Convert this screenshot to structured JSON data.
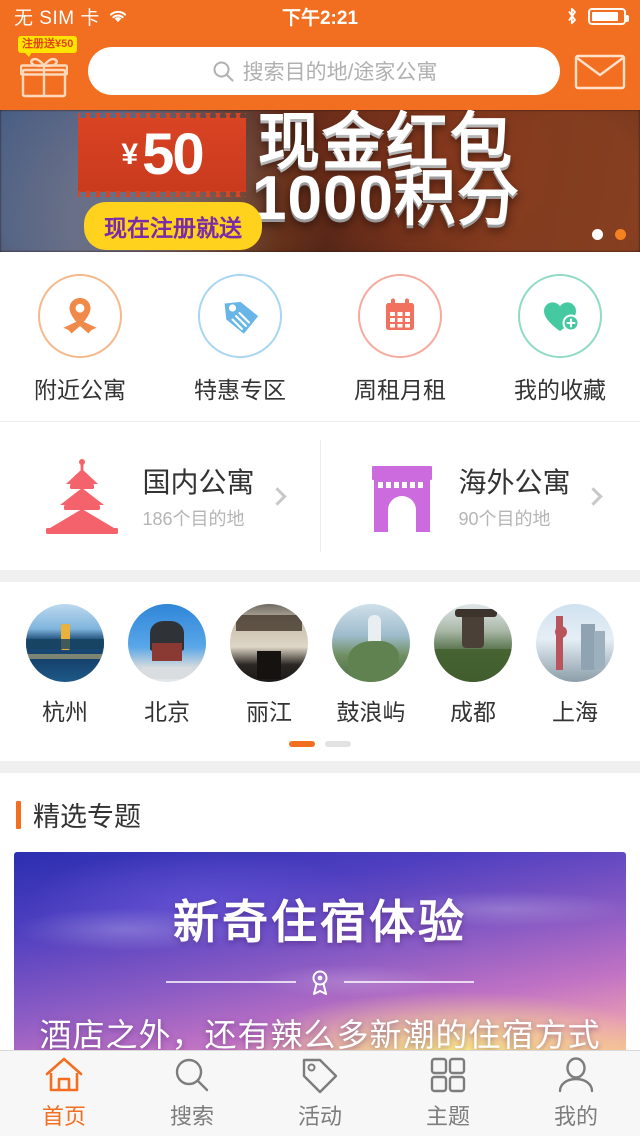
{
  "status_bar": {
    "carrier": "无 SIM 卡",
    "time": "下午2:21",
    "wifi_icon": "wifi-icon",
    "bluetooth_icon": "bluetooth-icon",
    "battery_icon": "battery-icon",
    "battery_level": 88
  },
  "header": {
    "gift_icon": "gift-icon",
    "gift_badge": "注册送¥50",
    "search_placeholder": "搜索目的地/途家公寓",
    "search_value": "",
    "search_icon": "search-icon",
    "mail_icon": "mail-icon"
  },
  "banner": {
    "coupon_currency": "¥",
    "coupon_amount": "50",
    "headline": "现金红包",
    "headline2": "1000积分",
    "pill": "现在注册就送",
    "dots": 2,
    "active_dot": 1,
    "active_dot_color": "#f58220"
  },
  "quick_actions": [
    {
      "label": "附近公寓",
      "icon": "location-pin-icon",
      "color": "#f08a4b",
      "ring": "#f5b98c"
    },
    {
      "label": "特惠专区",
      "icon": "price-tag-icon",
      "color": "#68b6e8",
      "ring": "#a9d6f2"
    },
    {
      "label": "周租月租",
      "icon": "calendar-icon",
      "color": "#f2705e",
      "ring": "#f6aba0"
    },
    {
      "label": "我的收藏",
      "icon": "heart-plus-icon",
      "color": "#44c9a0",
      "ring": "#8fdcc3"
    }
  ],
  "country_cards": [
    {
      "title": "国内公寓",
      "subtitle": "186个目的地",
      "icon": "temple-of-heaven-icon",
      "color": "#f4636b"
    },
    {
      "title": "海外公寓",
      "subtitle": "90个目的地",
      "icon": "arc-de-triomphe-icon",
      "color": "#cc6bdd"
    }
  ],
  "cities": [
    {
      "name": "杭州"
    },
    {
      "name": "北京"
    },
    {
      "name": "丽江"
    },
    {
      "name": "鼓浪屿"
    },
    {
      "name": "成都"
    },
    {
      "name": "上海"
    }
  ],
  "city_pager": {
    "count": 2,
    "active": 1,
    "active_color": "#f26f21"
  },
  "featured": {
    "section_title": "精选专题",
    "accent_color": "#f26f21",
    "promo_title": "新奇住宿体验",
    "promo_subtitle": "酒店之外，还有辣么多新潮的住宿方式",
    "promo_divider_icon": "medal-icon"
  },
  "tabs": [
    {
      "label": "首页",
      "icon": "home-icon",
      "active": true
    },
    {
      "label": "搜索",
      "icon": "search-icon",
      "active": false
    },
    {
      "label": "活动",
      "icon": "tag-icon",
      "active": false
    },
    {
      "label": "主题",
      "icon": "grid-icon",
      "active": false
    },
    {
      "label": "我的",
      "icon": "user-icon",
      "active": false
    }
  ],
  "theme": {
    "brand": "#f26f21",
    "bg": "#f0f0f0",
    "panel": "#ffffff"
  }
}
